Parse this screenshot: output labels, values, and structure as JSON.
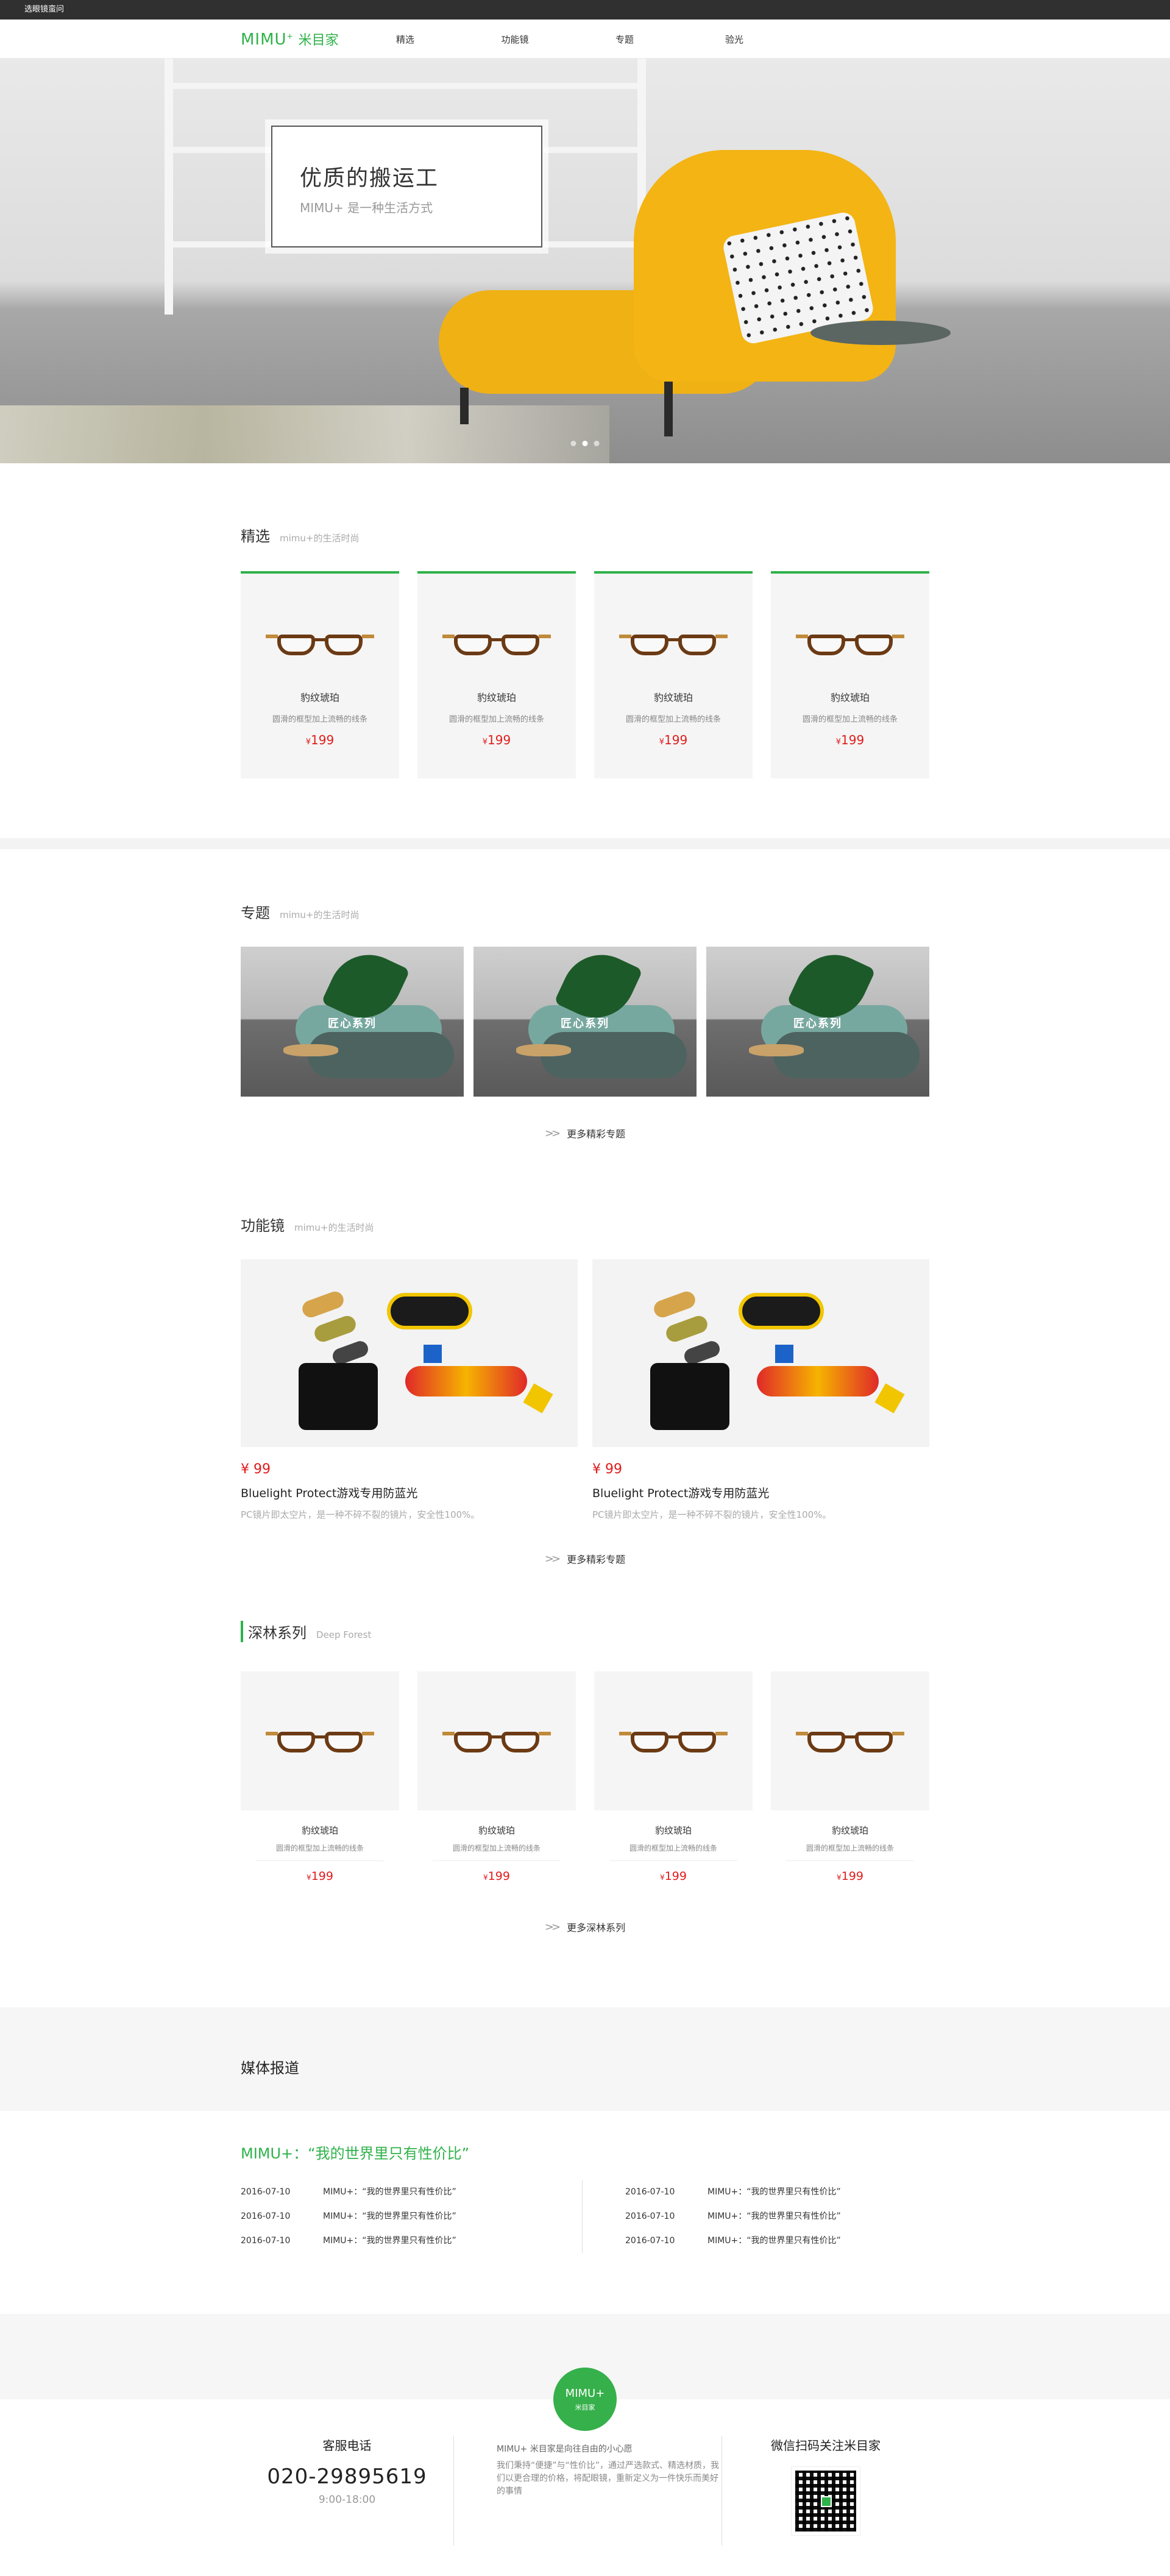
{
  "topbar": {
    "text": "选眼镜蛮问"
  },
  "nav": {
    "logo_en": "MIMU",
    "logo_sup": "+",
    "logo_cn": "米目家",
    "items": [
      "精选",
      "功能镜",
      "专题",
      "验光"
    ]
  },
  "hero": {
    "title": "优质的搬运工",
    "subtitle": "MIMU+ 是一种生活方式",
    "slide_count": 3,
    "active_slide": 1
  },
  "featured": {
    "title": "精选",
    "subtitle": "mimu+的生活时尚",
    "products": [
      {
        "name": "豹纹琥珀",
        "desc": "圆滑的框型加上流畅的线条",
        "currency": "¥",
        "price": "199"
      },
      {
        "name": "豹纹琥珀",
        "desc": "圆滑的框型加上流畅的线条",
        "currency": "¥",
        "price": "199"
      },
      {
        "name": "豹纹琥珀",
        "desc": "圆滑的框型加上流畅的线条",
        "currency": "¥",
        "price": "199"
      },
      {
        "name": "豹纹琥珀",
        "desc": "圆滑的框型加上流畅的线条",
        "currency": "¥",
        "price": "199"
      }
    ]
  },
  "topics": {
    "title": "专题",
    "subtitle": "mimu+的生活时尚",
    "tiles": [
      "匠心系列",
      "匠心系列",
      "匠心系列"
    ],
    "more": "更多精彩专题"
  },
  "function_glasses": {
    "title": "功能镜",
    "subtitle": "mimu+的生活时尚",
    "items": [
      {
        "price": "¥ 99",
        "title": "Bluelight Protect游戏专用防蓝光",
        "desc": "PC镜片即太空片，是一种不碎不裂的镜片，安全性100%。"
      },
      {
        "price": "¥ 99",
        "title": "Bluelight Protect游戏专用防蓝光",
        "desc": "PC镜片即太空片，是一种不碎不裂的镜片，安全性100%。"
      }
    ],
    "more": "更多精彩专题"
  },
  "deep_forest": {
    "title": "深林系列",
    "subtitle": "Deep Forest",
    "products": [
      {
        "name": "豹纹琥珀",
        "desc": "圆滑的框型加上流畅的线条",
        "currency": "¥",
        "price": "199"
      },
      {
        "name": "豹纹琥珀",
        "desc": "圆滑的框型加上流畅的线条",
        "currency": "¥",
        "price": "199"
      },
      {
        "name": "豹纹琥珀",
        "desc": "圆滑的框型加上流畅的线条",
        "currency": "¥",
        "price": "199"
      },
      {
        "name": "豹纹琥珀",
        "desc": "圆滑的框型加上流畅的线条",
        "currency": "¥",
        "price": "199"
      }
    ],
    "more": "更多深林系列"
  },
  "media": {
    "section_title": "媒体报道",
    "headline": "MIMU+：“我的世界里只有性价比”",
    "left": [
      {
        "date": "2016-07-10",
        "title": "MIMU+：“我的世界里只有性价比”"
      },
      {
        "date": "2016-07-10",
        "title": "MIMU+：“我的世界里只有性价比”"
      },
      {
        "date": "2016-07-10",
        "title": "MIMU+：“我的世界里只有性价比”"
      }
    ],
    "right": [
      {
        "date": "2016-07-10",
        "title": "MIMU+：“我的世界里只有性价比”"
      },
      {
        "date": "2016-07-10",
        "title": "MIMU+：“我的世界里只有性价比”"
      },
      {
        "date": "2016-07-10",
        "title": "MIMU+：“我的世界里只有性价比”"
      }
    ]
  },
  "footer": {
    "badge_en": "MIMU+",
    "badge_cn": "米目家",
    "service_title": "客服电话",
    "phone": "020-29895619",
    "hours": "9:00-18:00",
    "about_lead": "MIMU+ 米目家是向往自由的小心愿",
    "about_body": "我们秉持“便捷”与“性价比”，通过严选款式、精选材质，我们以更合理的价格，将配眼镜，重新定义为一件快乐而美好的事情",
    "wechat_title": "微信扫码关注米目家"
  },
  "colors": {
    "brand_green": "#2fb24a",
    "price_red": "#e01c1c",
    "topbar_bg": "#303030"
  }
}
